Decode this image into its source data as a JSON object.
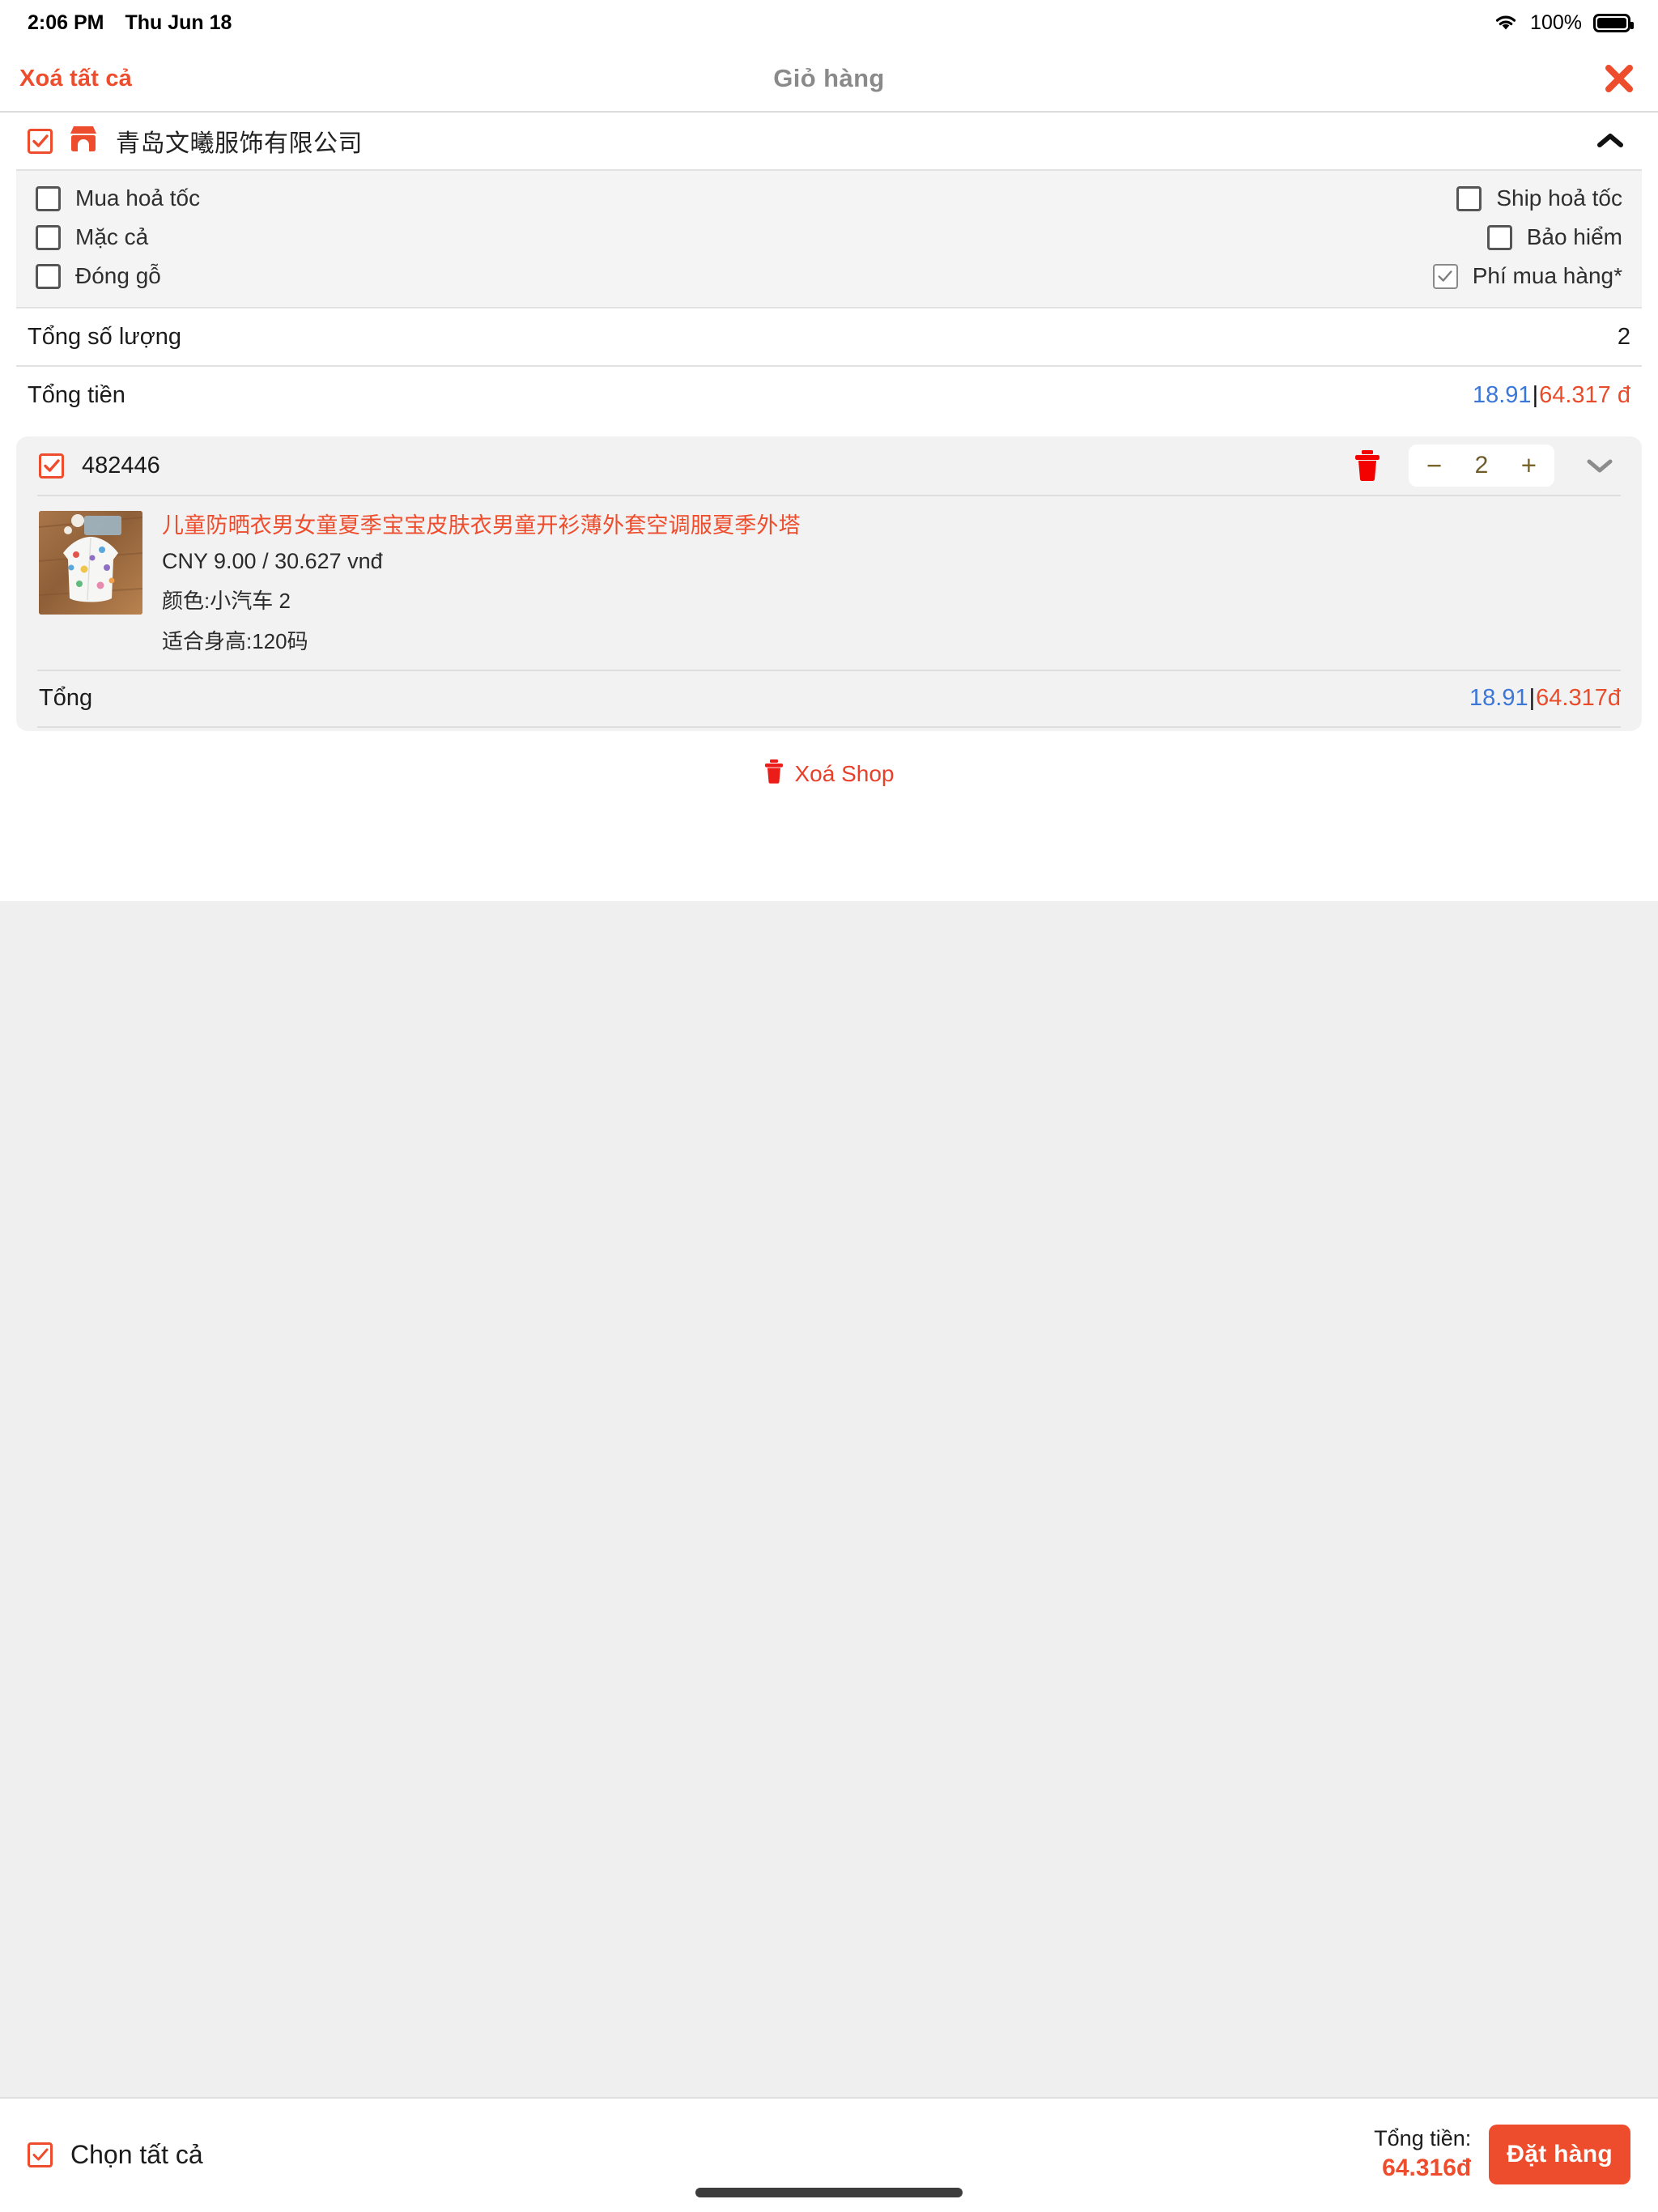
{
  "status_bar": {
    "time": "2:06 PM",
    "date": "Thu Jun 18",
    "battery_percent": "100%",
    "wifi_icon": "wifi-icon",
    "battery_icon": "battery-full-icon"
  },
  "nav": {
    "clear_all_label": "Xoá tất cả",
    "title": "Giỏ hàng",
    "close_icon": "close-icon"
  },
  "shop": {
    "checked": true,
    "store_icon": "storefront-icon",
    "name": "青岛文曦服饰有限公司",
    "collapse_icon": "chevron-up-icon",
    "options_left": [
      {
        "label": "Mua hoả tốc",
        "checked": false
      },
      {
        "label": "Mặc cả",
        "checked": false
      },
      {
        "label": "Đóng gỗ",
        "checked": false
      }
    ],
    "options_right": [
      {
        "label": "Ship hoả tốc",
        "checked": false
      },
      {
        "label": "Bảo hiểm",
        "checked": false
      },
      {
        "label": "Phí mua hàng*",
        "checked": true
      }
    ],
    "qty_row": {
      "label": "Tổng số lượng",
      "value": "2"
    },
    "money_row": {
      "label": "Tổng tiền",
      "amount_cny": "18.91",
      "separator": "|",
      "amount_vnd": "64.317 đ"
    }
  },
  "product": {
    "checked": true,
    "code": "482446",
    "delete_icon": "trash-icon",
    "stepper": {
      "minus": "−",
      "quantity": "2",
      "plus": "+"
    },
    "expand_icon": "chevron-down-icon",
    "thumbnail_icon": "product-image-kids-jacket",
    "title": "儿童防晒衣男女童夏季宝宝皮肤衣男童开衫薄外套空调服夏季外塔",
    "price": "CNY 9.00 / 30.627 vnđ",
    "attr_color": "颜色:小汽车 2",
    "attr_size": "适合身高:120码",
    "total_row": {
      "label": "Tổng",
      "amount_cny": "18.91",
      "separator": "|",
      "amount_vnd": "64.317đ"
    }
  },
  "delete_shop": {
    "icon": "trash-icon",
    "label": "Xoá Shop"
  },
  "bottom_bar": {
    "select_all_label": "Chọn tất cả",
    "select_all_checked": true,
    "total_label": "Tổng tiền:",
    "total_value": "64.316đ",
    "order_button_label": "Đặt hàng"
  },
  "colors": {
    "accent": "#ee4d2d",
    "money_blue": "#3b77d8",
    "money_red": "#ea4c2a",
    "trash_red": "#f30000"
  }
}
